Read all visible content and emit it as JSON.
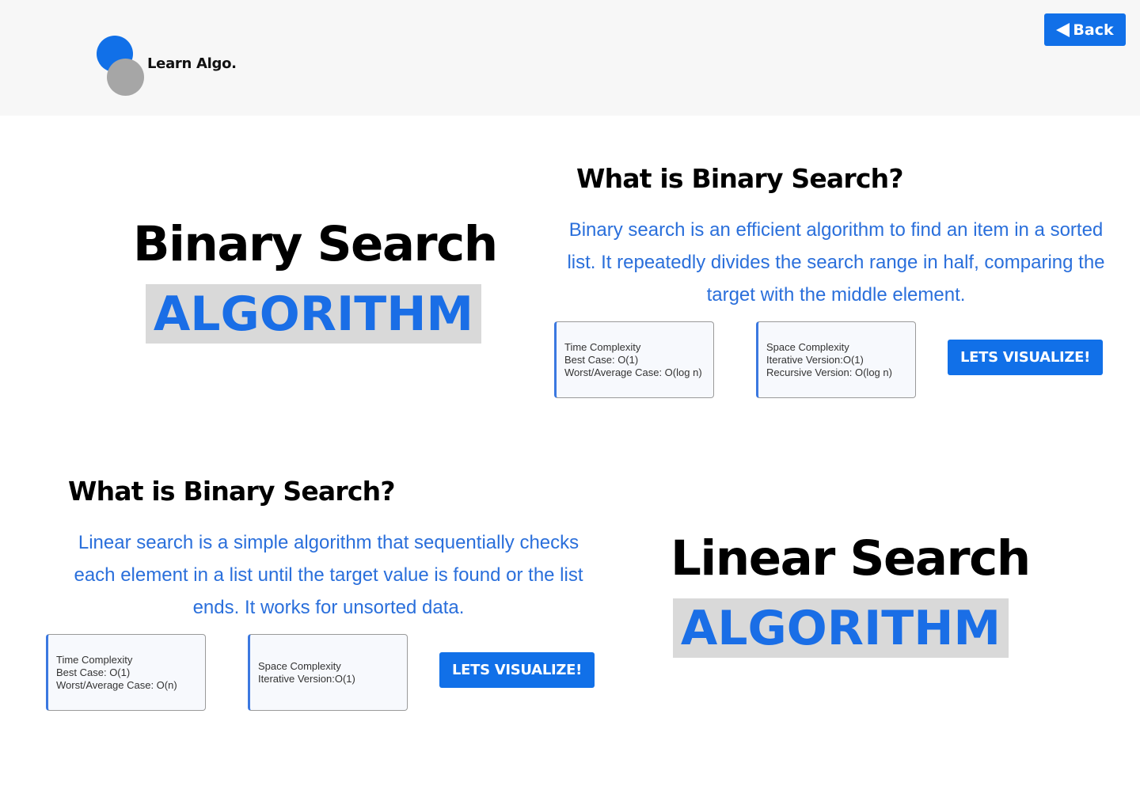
{
  "header": {
    "logo_text": "Learn Algo.",
    "back_label": "Back"
  },
  "binary": {
    "title": "Binary Search",
    "tag": "ALGORITHM",
    "question": "What is Binary Search?",
    "description": "Binary search is an efficient algorithm to find an item in a sorted list. It repeatedly divides the search range in half, comparing the target with the middle element.",
    "time_card": [
      "Time Complexity",
      "Best Case: O(1)",
      "Worst/Average Case: O(log n)"
    ],
    "space_card": [
      "Space Complexity",
      "Iterative Version:O(1)",
      "Recursive Version: O(log n)"
    ],
    "button": "LETS VISUALIZE!"
  },
  "linear": {
    "title": "Linear Search",
    "tag": "ALGORITHM",
    "question": "What is Binary Search?",
    "description": "Linear search is a simple algorithm that sequentially checks each element in a list until the target value is found or the list ends. It works for unsorted data.",
    "time_card": [
      "Time Complexity",
      "Best Case: O(1)",
      "Worst/Average Case: O(n)"
    ],
    "space_card": [
      "Space Complexity",
      "Iterative Version:O(1)"
    ],
    "button": "LETS VISUALIZE!"
  },
  "colors": {
    "accent": "#1170e8",
    "text_blue": "#2a6fdb",
    "tag_bg": "#d9d9d9",
    "header_bg": "#f7f7f7"
  }
}
